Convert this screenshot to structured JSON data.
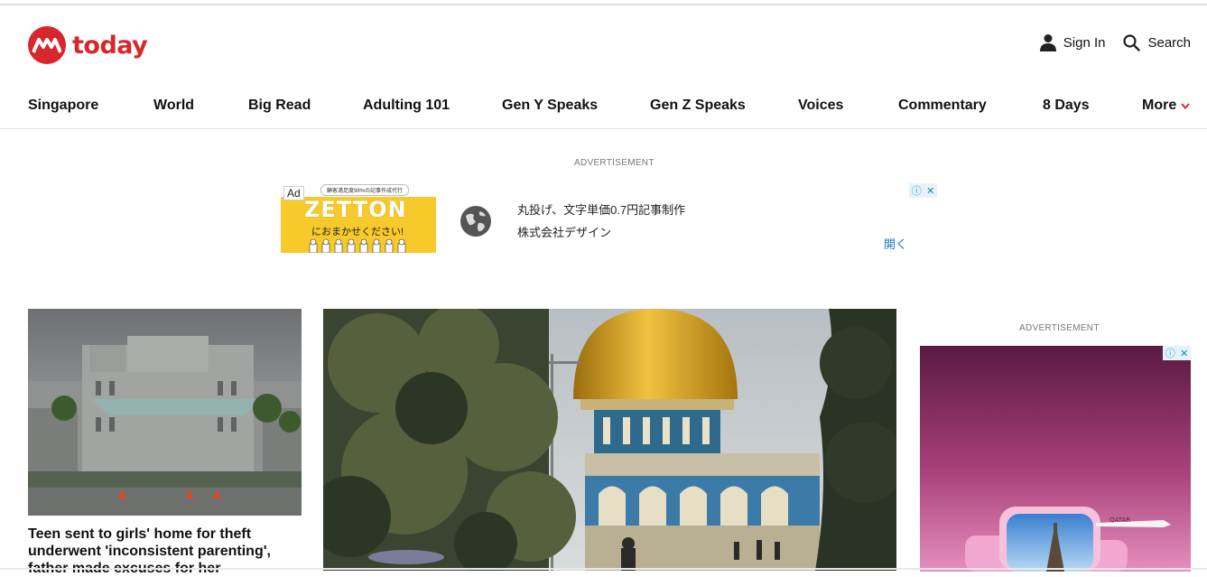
{
  "site": {
    "logo_text": "today"
  },
  "header": {
    "sign_in": "Sign In",
    "search": "Search"
  },
  "nav": {
    "items": [
      "Singapore",
      "World",
      "Big Read",
      "Adulting 101",
      "Gen Y Speaks",
      "Gen Z Speaks",
      "Voices",
      "Commentary",
      "8 Days"
    ],
    "more": "More"
  },
  "ads": {
    "top_label": "ADVERTISEMENT",
    "side_label": "ADVERTISEMENT",
    "ad_badge": "Ad",
    "zetton_tag": "顧客満足度98%の記事作成代行",
    "zetton_title": "ZETTON",
    "zetton_sub": "におまかせください!",
    "line1": "丸投げ、文字単価0.7円記事制作",
    "line2": "株式会社デザイン",
    "open": "開く",
    "side_brand": "QATAR"
  },
  "stories": {
    "left_headline": "Teen sent to girls' home for theft underwent 'inconsistent parenting', father made excuses for her"
  },
  "colors": {
    "brand_red": "#d7262c",
    "ad_yellow": "#f7c92a",
    "link_blue": "#1a73c9"
  }
}
